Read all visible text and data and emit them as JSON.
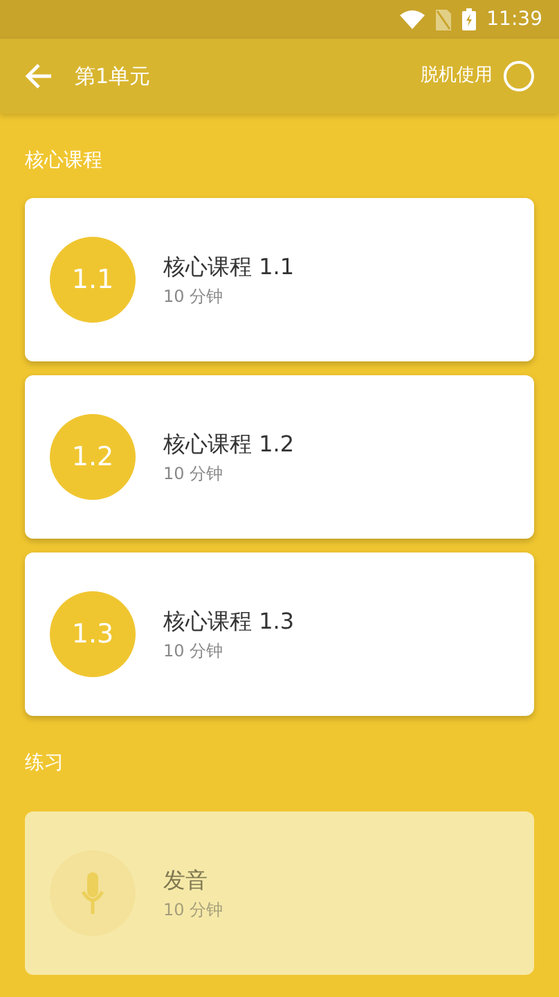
{
  "status_bar": {
    "time": "11:39"
  },
  "app_bar": {
    "title": "第1单元",
    "offline": {
      "label": "脱机使用",
      "on": false
    }
  },
  "sections": [
    {
      "title": "核心课程",
      "items": [
        {
          "kind": "number",
          "badge": "1.1",
          "title": "核心课程 1.1",
          "duration": "10 分钟",
          "disabled": false
        },
        {
          "kind": "number",
          "badge": "1.2",
          "title": "核心课程 1.2",
          "duration": "10 分钟",
          "disabled": false
        },
        {
          "kind": "number",
          "badge": "1.3",
          "title": "核心课程 1.3",
          "duration": "10 分钟",
          "disabled": false
        }
      ]
    },
    {
      "title": "练习",
      "items": [
        {
          "kind": "mic",
          "title": "发音",
          "duration": "10 分钟",
          "disabled": true
        }
      ]
    }
  ]
}
